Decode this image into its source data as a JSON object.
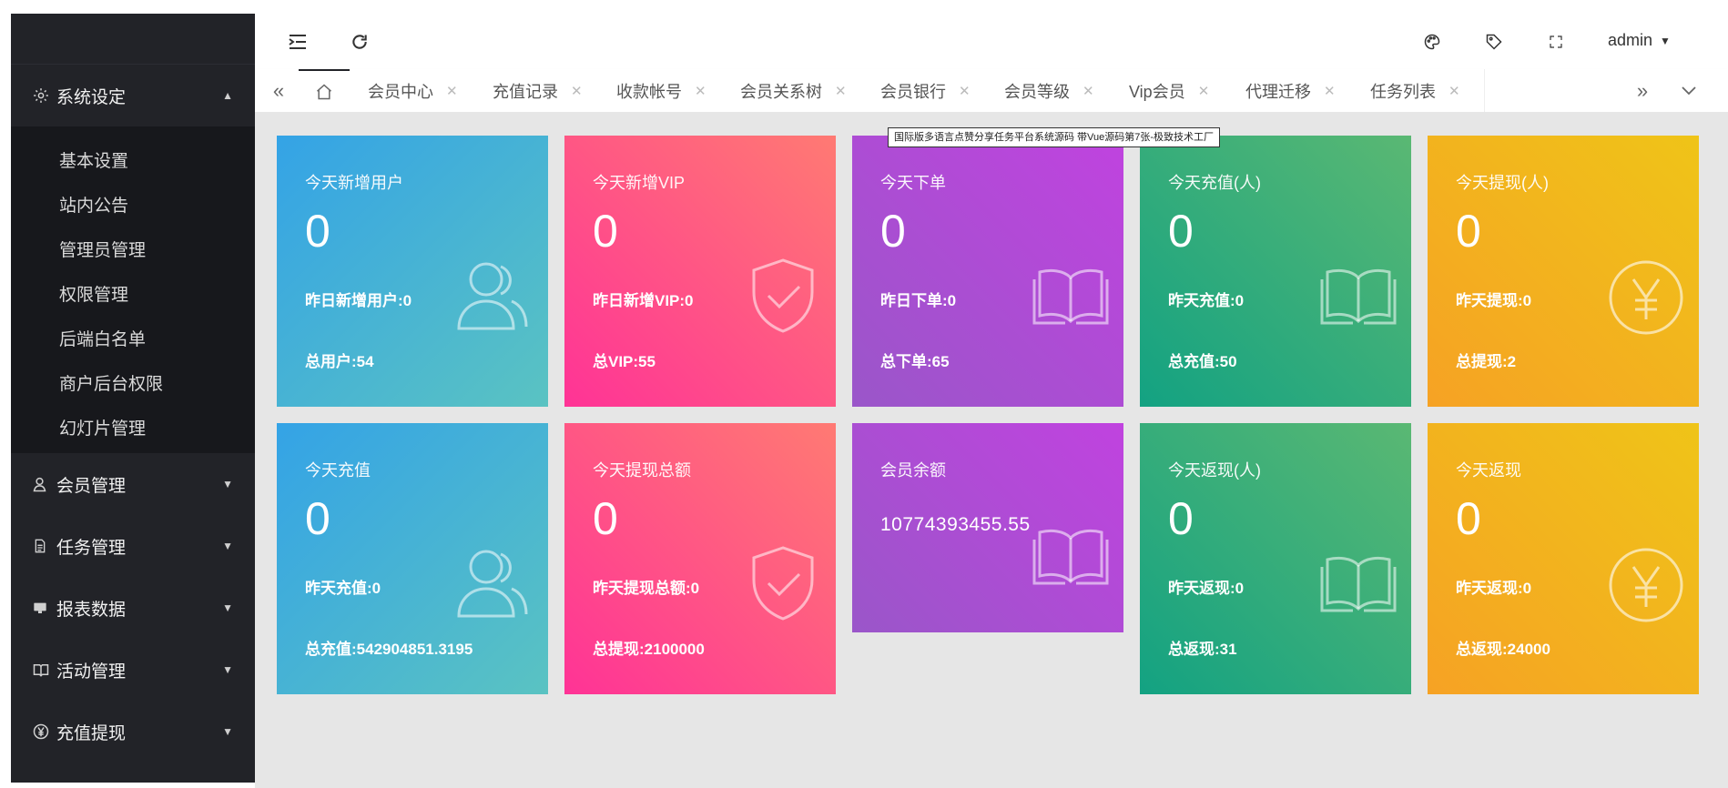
{
  "sidebar": {
    "system_menu": {
      "label": "系统设定",
      "items": [
        "基本设置",
        "站内公告",
        "管理员管理",
        "权限管理",
        "后端白名单",
        "商户后台权限",
        "幻灯片管理"
      ]
    },
    "menus": [
      {
        "label": "会员管理",
        "icon": "user-icon"
      },
      {
        "label": "任务管理",
        "icon": "document-icon"
      },
      {
        "label": "报表数据",
        "icon": "report-icon"
      },
      {
        "label": "活动管理",
        "icon": "activity-icon"
      },
      {
        "label": "充值提现",
        "icon": "yen-icon"
      }
    ]
  },
  "header": {
    "user": "admin"
  },
  "tabs": [
    "会员中心",
    "充值记录",
    "收款帐号",
    "会员关系树",
    "会员银行",
    "会员等级",
    "Vip会员",
    "代理迁移",
    "任务列表"
  ],
  "tooltip": "国际版多语言点赞分享任务平台系统源码 带Vue源码第7张-极致技术工厂",
  "cards_row1": [
    {
      "title": "今天新增用户",
      "value": "0",
      "yesterday": "昨日新增用户:0",
      "total": "总用户:54",
      "icon": "users-icon"
    },
    {
      "title": "今天新增VIP",
      "value": "0",
      "yesterday": "昨日新增VIP:0",
      "total": "总VIP:55",
      "icon": "shield-check-icon"
    },
    {
      "title": "今天下单",
      "value": "0",
      "yesterday": "昨日下单:0",
      "total": "总下单:65",
      "icon": "book-icon"
    },
    {
      "title": "今天充值(人)",
      "value": "0",
      "yesterday": "昨天充值:0",
      "total": "总充值:50",
      "icon": "book-icon"
    },
    {
      "title": "今天提现(人)",
      "value": "0",
      "yesterday": "昨天提现:0",
      "total": "总提现:2",
      "icon": "yen-circle-icon"
    }
  ],
  "cards_row2": [
    {
      "title": "今天充值",
      "value": "0",
      "yesterday": "昨天充值:0",
      "total": "总充值:542904851.3195",
      "icon": "users-icon"
    },
    {
      "title": "今天提现总额",
      "value": "0",
      "yesterday": "昨天提现总额:0",
      "total": "总提现:2100000",
      "icon": "shield-check-icon"
    },
    {
      "title": "会员余额",
      "value": "10774393455.55",
      "icon": "book-icon"
    },
    {
      "title": "今天返现(人)",
      "value": "0",
      "yesterday": "昨天返现:0",
      "total": "总返现:31",
      "icon": "book-icon"
    },
    {
      "title": "今天返现",
      "value": "0",
      "yesterday": "昨天返现:0",
      "total": "总返现:24000",
      "icon": "yen-circle-icon"
    }
  ]
}
